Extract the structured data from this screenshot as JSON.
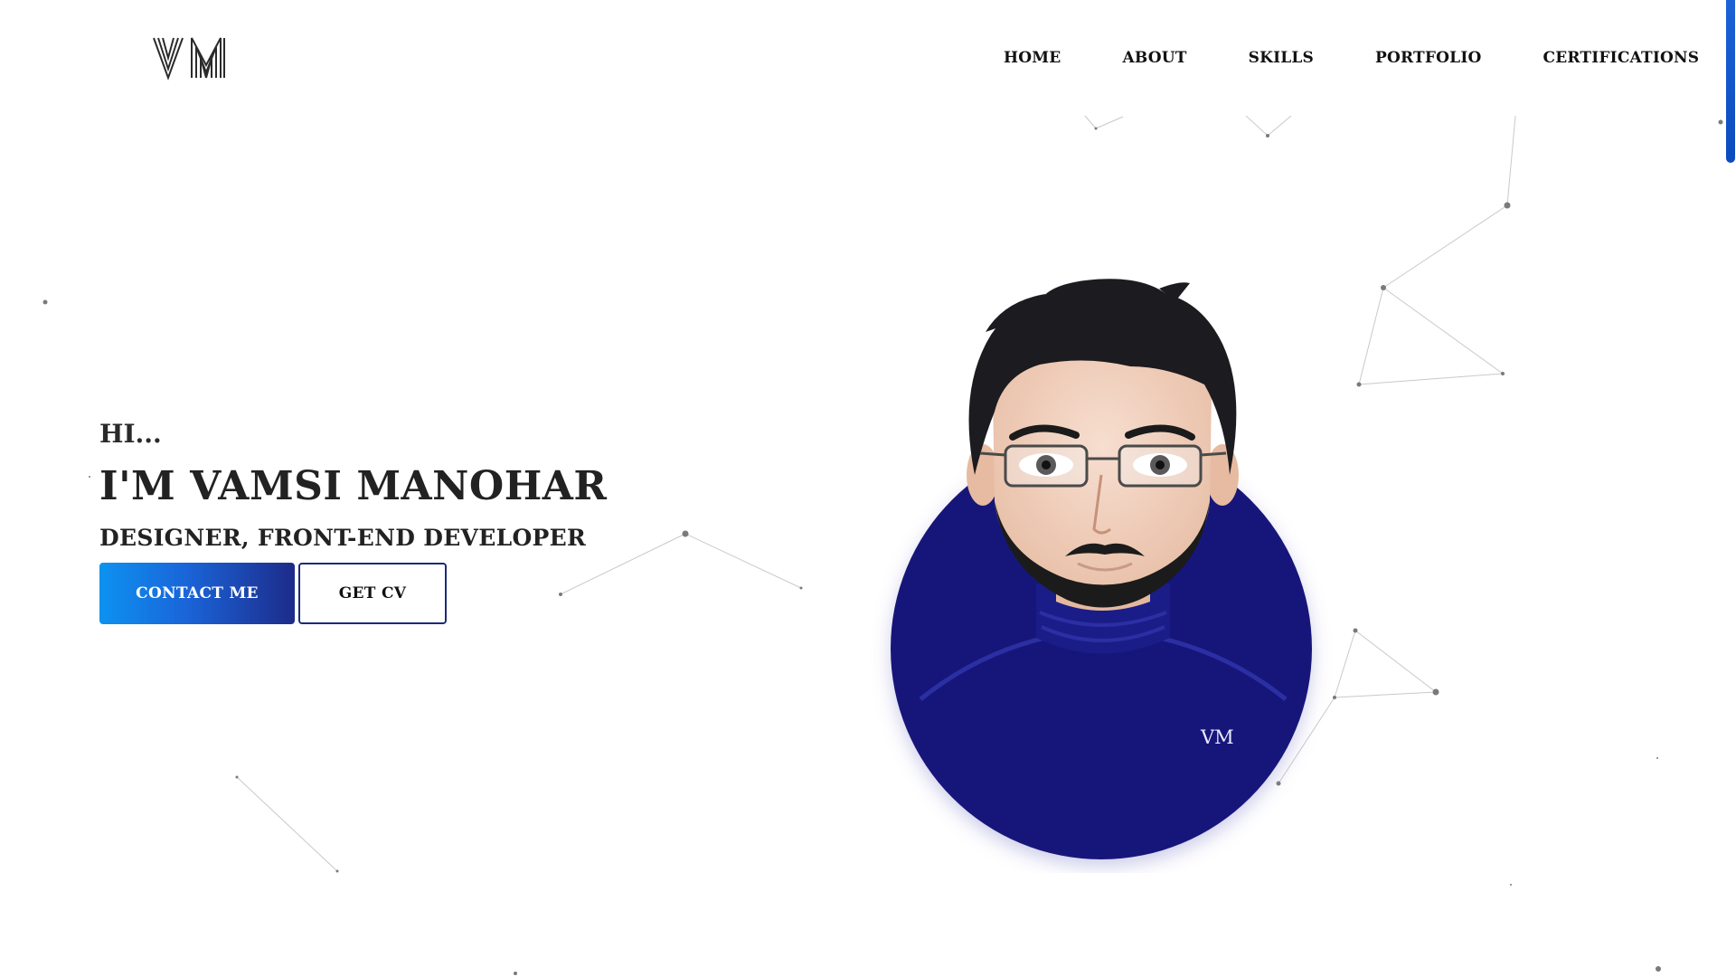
{
  "brand": {
    "logo_text": "VM"
  },
  "nav": {
    "items": [
      {
        "label": "HOME"
      },
      {
        "label": "ABOUT"
      },
      {
        "label": "SKILLS"
      },
      {
        "label": "PORTFOLIO"
      },
      {
        "label": "CERTIFICATIONS"
      }
    ]
  },
  "hero": {
    "greeting": "HI...",
    "name": "I'M VAMSI MANOHAR",
    "role": "DESIGNER, FRONT-END DEVELOPER",
    "contact_label": "CONTACT ME",
    "cv_label": "GET CV"
  },
  "avatar": {
    "mark": "VM"
  },
  "colors": {
    "accent_blue": "#0d92f0",
    "accent_navy": "#1d2b8a",
    "avatar_circle": "#16187a",
    "scroll_thumb": "#1c63d6"
  }
}
